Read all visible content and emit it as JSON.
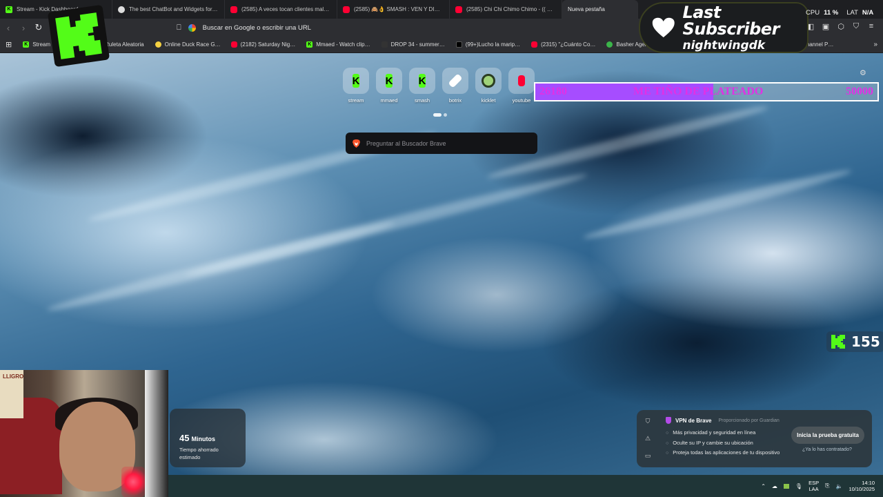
{
  "tabs": [
    {
      "label": "Stream - Kick Dashboard",
      "icon": "kick-icon"
    },
    {
      "label": "The best ChatBot and Widgets for Ki…",
      "icon": "botrix-icon"
    },
    {
      "label": "(2585) A veces tocan clientes mala o…",
      "icon": "youtube-icon"
    },
    {
      "label": "(2585) 🙈👌 SMASH : VEN Y DIMELO",
      "icon": "youtube-icon"
    },
    {
      "label": "(2585) Chi Chi Chimo Chimo - (( Mit…",
      "icon": "youtube-icon"
    },
    {
      "label": "Nueva pestaña",
      "icon": "",
      "active": true
    }
  ],
  "toolbar": {
    "url_placeholder": "Buscar en Google o escribir una URL"
  },
  "bookmarks": [
    {
      "label": "Stream",
      "icon": "kick"
    },
    {
      "label": "La Ruleta Aleatoria",
      "icon": "roulette"
    },
    {
      "label": "Online Duck Race G…",
      "icon": "duck"
    },
    {
      "label": "(2182) Saturday Nig…",
      "icon": "yt"
    },
    {
      "label": "Mmaed - Watch clip…",
      "icon": "kick"
    },
    {
      "label": "DROP 34 - summer…",
      "icon": "box"
    },
    {
      "label": "(99+)Lucho la marip…",
      "icon": "tt"
    },
    {
      "label": "(2315) \"¿Cuánto Co…",
      "icon": "yt"
    },
    {
      "label": "Basher Agency | Inst…",
      "icon": "star"
    },
    {
      "label": "…e to Channel P…",
      "icon": ""
    }
  ],
  "last_subscriber": {
    "title": "Last Subscriber",
    "name": "nightwingdk"
  },
  "system": {
    "cpu_label": "CPU",
    "cpu_value": "11 %",
    "lat_label": "LAT",
    "lat_value": "N/A"
  },
  "shortcuts": [
    {
      "label": "stream",
      "icon": "kick"
    },
    {
      "label": "mmaed",
      "icon": "kick"
    },
    {
      "label": "smash",
      "icon": "kick"
    },
    {
      "label": "botrix",
      "icon": "botrix"
    },
    {
      "label": "kicklet",
      "icon": "kicklet"
    },
    {
      "label": "youtube",
      "icon": "youtube"
    }
  ],
  "goal": {
    "current": "26180",
    "title": "ME TIÑO DE PLATEADO",
    "target": "50000",
    "progress": 0.52,
    "fill_color": "#a64dff",
    "text_color": "#e22fe6"
  },
  "search": {
    "placeholder": "Preguntar al Buscador Brave"
  },
  "kick_counter": {
    "value": "155"
  },
  "webcam": {
    "sign_text": "LLIGRO"
  },
  "time_saved": {
    "value": "45",
    "unit": "Minutos",
    "description": "Tiempo ahorrado estimado"
  },
  "vpn": {
    "title": "VPN de Brave",
    "provider": "Proporcionado por Guardian",
    "features": [
      "Más privacidad y seguridad en línea",
      "Oculte su IP y cambie su ubicación",
      "Proteja todas las aplicaciones de tu dispositivo"
    ],
    "cta": "Inicia la prueba gratuita",
    "already": "¿Ya lo has contratado?"
  },
  "taskbar": {
    "lang_top": "ESP",
    "lang_bottom": "LAA",
    "time": "14:10",
    "date": "10/10/2025"
  },
  "colors": {
    "kick_green": "#53fc18",
    "youtube_red": "#ff0033",
    "tab_bg": "#1e1f22",
    "toolbar_bg": "#2d2e32"
  }
}
